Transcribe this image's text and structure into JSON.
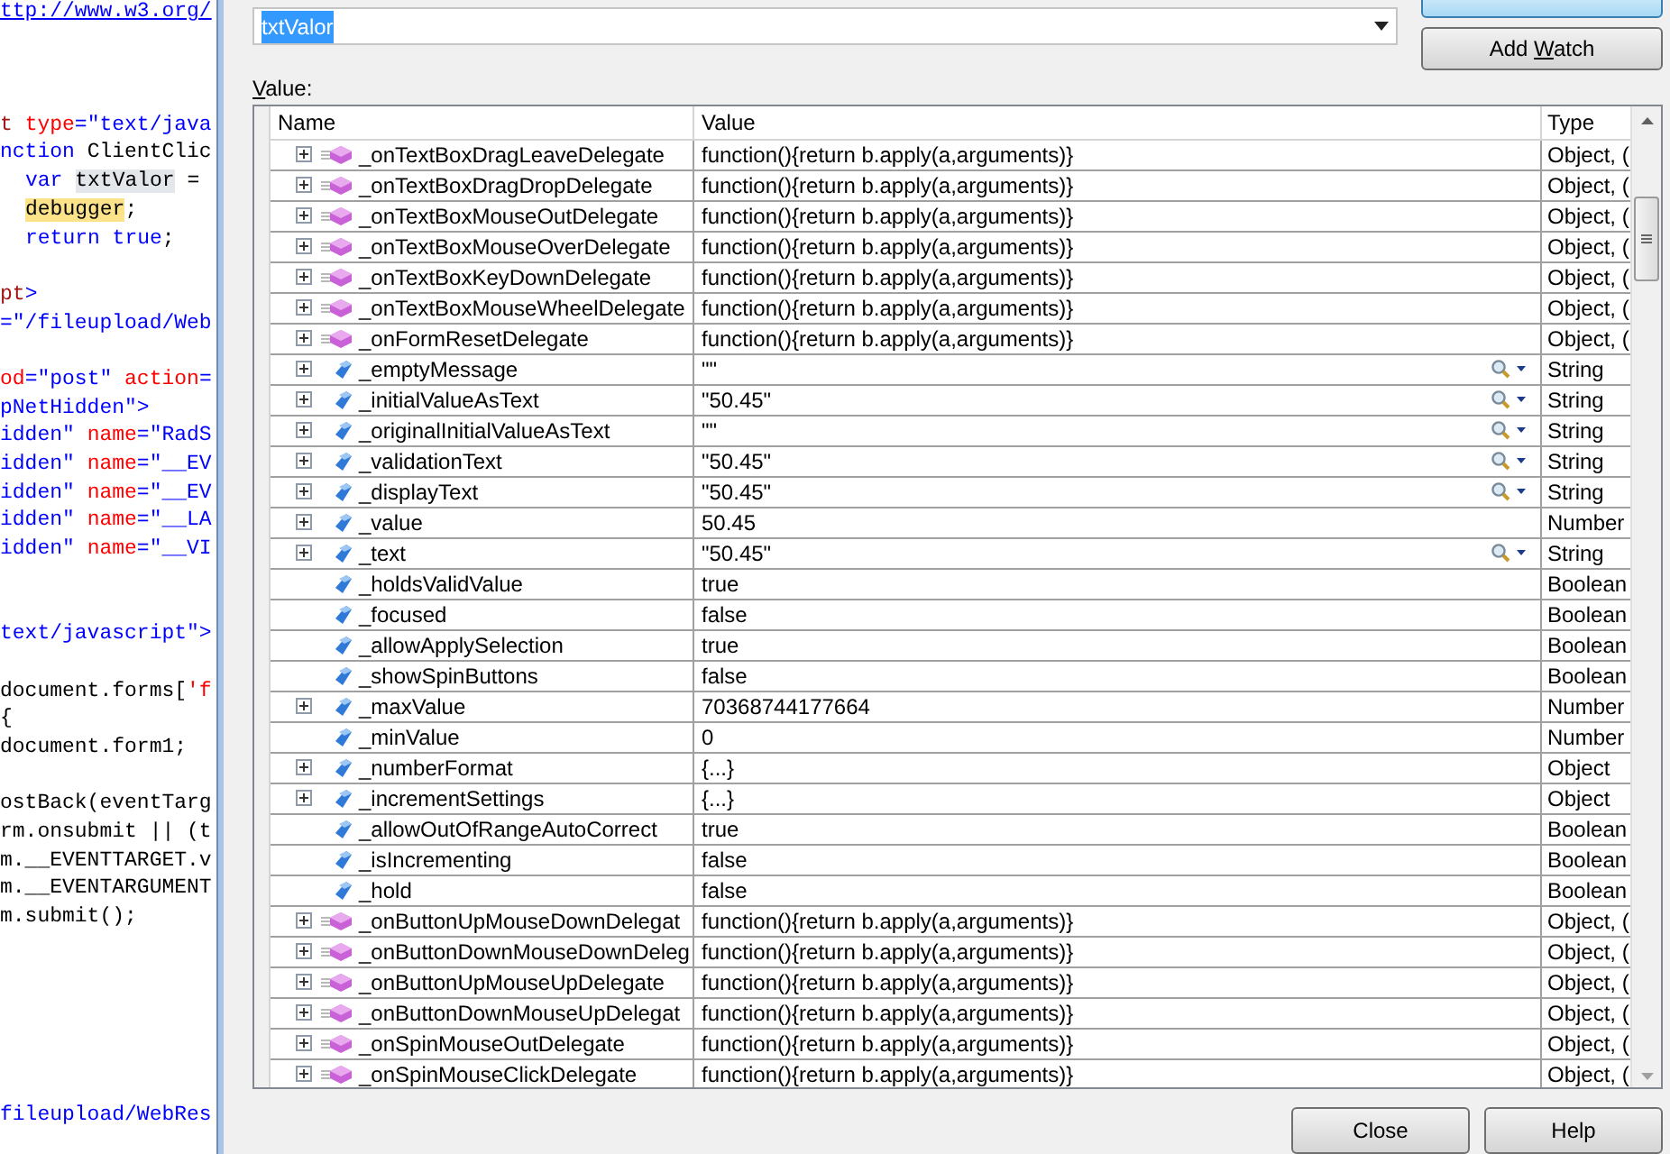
{
  "editor": {
    "lines": [
      {
        "kind": "code",
        "tokens": [
          {
            "kind": "link",
            "text": "ttp://www.w3.org/"
          }
        ]
      },
      {
        "kind": "blank"
      },
      {
        "kind": "blank"
      },
      {
        "kind": "blank"
      },
      {
        "kind": "code",
        "tokens": [
          {
            "kind": "tag",
            "text": "t "
          },
          {
            "kind": "attr",
            "text": "type"
          },
          {
            "kind": "string",
            "text": "=\"text/java"
          }
        ]
      },
      {
        "kind": "code",
        "tokens": [
          {
            "kind": "keyword",
            "text": "nction "
          },
          {
            "kind": "plain",
            "text": "ClientClic"
          }
        ]
      },
      {
        "kind": "code",
        "indented": true,
        "tokens": [
          {
            "kind": "keyword",
            "text": "var "
          },
          {
            "kind": "ref",
            "text": "txtValor"
          },
          {
            "kind": "plain",
            "text": " ="
          }
        ]
      },
      {
        "kind": "code",
        "indented": true,
        "tokens": [
          {
            "kind": "break",
            "text": "debugger"
          },
          {
            "kind": "plain",
            "text": ";"
          }
        ]
      },
      {
        "kind": "code",
        "indented": true,
        "tokens": [
          {
            "kind": "keyword",
            "text": "return true"
          },
          {
            "kind": "plain",
            "text": ";"
          }
        ]
      },
      {
        "kind": "blank"
      },
      {
        "kind": "code",
        "tokens": [
          {
            "kind": "tag",
            "text": "pt"
          },
          {
            "kind": "string",
            "text": ">"
          }
        ]
      },
      {
        "kind": "code",
        "tokens": [
          {
            "kind": "string",
            "text": "=\"/fileupload/Web"
          }
        ]
      },
      {
        "kind": "blank"
      },
      {
        "kind": "code",
        "tokens": [
          {
            "kind": "attr",
            "text": "od"
          },
          {
            "kind": "string",
            "text": "=\"post\" "
          },
          {
            "kind": "attr",
            "text": "action"
          },
          {
            "kind": "string",
            "text": "="
          }
        ]
      },
      {
        "kind": "code",
        "tokens": [
          {
            "kind": "string",
            "text": "pNetHidden\">"
          }
        ]
      },
      {
        "kind": "code",
        "tokens": [
          {
            "kind": "string",
            "text": "idden\" "
          },
          {
            "kind": "attr",
            "text": "name"
          },
          {
            "kind": "string",
            "text": "=\"RadS"
          }
        ]
      },
      {
        "kind": "code",
        "tokens": [
          {
            "kind": "string",
            "text": "idden\" "
          },
          {
            "kind": "attr",
            "text": "name"
          },
          {
            "kind": "string",
            "text": "=\"__EV"
          }
        ]
      },
      {
        "kind": "code",
        "tokens": [
          {
            "kind": "string",
            "text": "idden\" "
          },
          {
            "kind": "attr",
            "text": "name"
          },
          {
            "kind": "string",
            "text": "=\"__EV"
          }
        ]
      },
      {
        "kind": "code",
        "tokens": [
          {
            "kind": "string",
            "text": "idden\" "
          },
          {
            "kind": "attr",
            "text": "name"
          },
          {
            "kind": "string",
            "text": "=\"__LA"
          }
        ]
      },
      {
        "kind": "code",
        "tokens": [
          {
            "kind": "string",
            "text": "idden\" "
          },
          {
            "kind": "attr",
            "text": "name"
          },
          {
            "kind": "string",
            "text": "=\"__VI"
          }
        ]
      },
      {
        "kind": "blank"
      },
      {
        "kind": "blank"
      },
      {
        "kind": "code",
        "tokens": [
          {
            "kind": "string",
            "text": "text/javascript\">"
          }
        ]
      },
      {
        "kind": "blank"
      },
      {
        "kind": "code",
        "tokens": [
          {
            "kind": "plain",
            "text": "document.forms["
          },
          {
            "kind": "attr",
            "text": "'f"
          }
        ]
      },
      {
        "kind": "code",
        "tokens": [
          {
            "kind": "plain",
            "text": "{"
          }
        ]
      },
      {
        "kind": "code",
        "tokens": [
          {
            "kind": "plain",
            "text": "document.form1;"
          }
        ]
      },
      {
        "kind": "blank"
      },
      {
        "kind": "code",
        "tokens": [
          {
            "kind": "plain",
            "text": "ostBack(eventTarg"
          }
        ]
      },
      {
        "kind": "code",
        "tokens": [
          {
            "kind": "plain",
            "text": "rm.onsubmit || (t"
          }
        ]
      },
      {
        "kind": "code",
        "tokens": [
          {
            "kind": "plain",
            "text": "m.__EVENTTARGET.v"
          }
        ]
      },
      {
        "kind": "code",
        "tokens": [
          {
            "kind": "plain",
            "text": "m.__EVENTARGUMENT"
          }
        ]
      },
      {
        "kind": "code",
        "tokens": [
          {
            "kind": "plain",
            "text": "m.submit();"
          }
        ]
      },
      {
        "kind": "blank"
      },
      {
        "kind": "blank"
      },
      {
        "kind": "blank"
      },
      {
        "kind": "blank"
      },
      {
        "kind": "blank"
      },
      {
        "kind": "blank"
      },
      {
        "kind": "code",
        "tokens": [
          {
            "kind": "string",
            "text": "fileupload/WebRes"
          }
        ]
      }
    ]
  },
  "dialog": {
    "expression": {
      "value": "txtValor",
      "text_selected": true
    },
    "buttons_top": [
      {
        "kind": "default"
      },
      {
        "kind": "normal",
        "label": "Add Watch"
      }
    ],
    "value_label": {
      "text": "Value:"
    },
    "grid": {
      "columns": [
        "Name",
        "Value",
        "Type"
      ],
      "rows": [
        {
          "name": "_onTextBoxDragLeaveDelegate",
          "value": "function(){return b.apply(a,arguments)}",
          "type": "Object, (",
          "expandable": true,
          "kind": "method",
          "visualizer": false
        },
        {
          "name": "_onTextBoxDragDropDelegate",
          "value": "function(){return b.apply(a,arguments)}",
          "type": "Object, (",
          "expandable": true,
          "kind": "method",
          "visualizer": false
        },
        {
          "name": "_onTextBoxMouseOutDelegate",
          "value": "function(){return b.apply(a,arguments)}",
          "type": "Object, (",
          "expandable": true,
          "kind": "method",
          "visualizer": false
        },
        {
          "name": "_onTextBoxMouseOverDelegate",
          "value": "function(){return b.apply(a,arguments)}",
          "type": "Object, (",
          "expandable": true,
          "kind": "method",
          "visualizer": false
        },
        {
          "name": "_onTextBoxKeyDownDelegate",
          "value": "function(){return b.apply(a,arguments)}",
          "type": "Object, (",
          "expandable": true,
          "kind": "method",
          "visualizer": false
        },
        {
          "name": "_onTextBoxMouseWheelDelegate",
          "value": "function(){return b.apply(a,arguments)}",
          "type": "Object, (",
          "expandable": true,
          "kind": "method",
          "visualizer": false
        },
        {
          "name": "_onFormResetDelegate",
          "value": "function(){return b.apply(a,arguments)}",
          "type": "Object, (",
          "expandable": true,
          "kind": "method",
          "visualizer": false
        },
        {
          "name": "_emptyMessage",
          "value": "\"\"",
          "type": "String",
          "expandable": true,
          "kind": "property",
          "visualizer": true
        },
        {
          "name": "_initialValueAsText",
          "value": "\"50.45\"",
          "type": "String",
          "expandable": true,
          "kind": "property",
          "visualizer": true
        },
        {
          "name": "_originalInitialValueAsText",
          "value": "\"\"",
          "type": "String",
          "expandable": true,
          "kind": "property",
          "visualizer": true
        },
        {
          "name": "_validationText",
          "value": "\"50.45\"",
          "type": "String",
          "expandable": true,
          "kind": "property",
          "visualizer": true
        },
        {
          "name": "_displayText",
          "value": "\"50.45\"",
          "type": "String",
          "expandable": true,
          "kind": "property",
          "visualizer": true
        },
        {
          "name": "_value",
          "value": "50.45",
          "type": "Number",
          "expandable": true,
          "kind": "property",
          "visualizer": false
        },
        {
          "name": "_text",
          "value": "\"50.45\"",
          "type": "String",
          "expandable": true,
          "kind": "property",
          "visualizer": true
        },
        {
          "name": "_holdsValidValue",
          "value": "true",
          "type": "Boolean",
          "expandable": false,
          "kind": "property",
          "visualizer": false
        },
        {
          "name": "_focused",
          "value": "false",
          "type": "Boolean",
          "expandable": false,
          "kind": "property",
          "visualizer": false
        },
        {
          "name": "_allowApplySelection",
          "value": "true",
          "type": "Boolean",
          "expandable": false,
          "kind": "property",
          "visualizer": false
        },
        {
          "name": "_showSpinButtons",
          "value": "false",
          "type": "Boolean",
          "expandable": false,
          "kind": "property",
          "visualizer": false
        },
        {
          "name": "_maxValue",
          "value": "70368744177664",
          "type": "Number",
          "expandable": true,
          "kind": "property",
          "visualizer": false
        },
        {
          "name": "_minValue",
          "value": "0",
          "type": "Number",
          "expandable": false,
          "kind": "property",
          "visualizer": false
        },
        {
          "name": "_numberFormat",
          "value": "{...}",
          "type": "Object",
          "expandable": true,
          "kind": "property",
          "visualizer": false
        },
        {
          "name": "_incrementSettings",
          "value": "{...}",
          "type": "Object",
          "expandable": true,
          "kind": "property",
          "visualizer": false
        },
        {
          "name": "_allowOutOfRangeAutoCorrect",
          "value": "true",
          "type": "Boolean",
          "expandable": false,
          "kind": "property",
          "visualizer": false
        },
        {
          "name": "_isIncrementing",
          "value": "false",
          "type": "Boolean",
          "expandable": false,
          "kind": "property",
          "visualizer": false
        },
        {
          "name": "_hold",
          "value": "false",
          "type": "Boolean",
          "expandable": false,
          "kind": "property",
          "visualizer": false
        },
        {
          "name": "_onButtonUpMouseDownDelegat",
          "value": "function(){return b.apply(a,arguments)}",
          "type": "Object, (",
          "expandable": true,
          "kind": "method",
          "visualizer": false
        },
        {
          "name": "_onButtonDownMouseDownDeleg",
          "value": "function(){return b.apply(a,arguments)}",
          "type": "Object, (",
          "expandable": true,
          "kind": "method",
          "visualizer": false
        },
        {
          "name": "_onButtonUpMouseUpDelegate",
          "value": "function(){return b.apply(a,arguments)}",
          "type": "Object, (",
          "expandable": true,
          "kind": "method",
          "visualizer": false
        },
        {
          "name": "_onButtonDownMouseUpDelegat",
          "value": "function(){return b.apply(a,arguments)}",
          "type": "Object, (",
          "expandable": true,
          "kind": "method",
          "visualizer": false
        },
        {
          "name": "_onSpinMouseOutDelegate",
          "value": "function(){return b.apply(a,arguments)}",
          "type": "Object, (",
          "expandable": true,
          "kind": "method",
          "visualizer": false
        },
        {
          "name": "_onSpinMouseClickDelegate",
          "value": "function(){return b.apply(a,arguments)}",
          "type": "Object, (",
          "expandable": true,
          "kind": "method",
          "visualizer": false
        }
      ]
    },
    "buttons_bottom": [
      {
        "label": "Close"
      },
      {
        "label": "Help"
      }
    ]
  }
}
